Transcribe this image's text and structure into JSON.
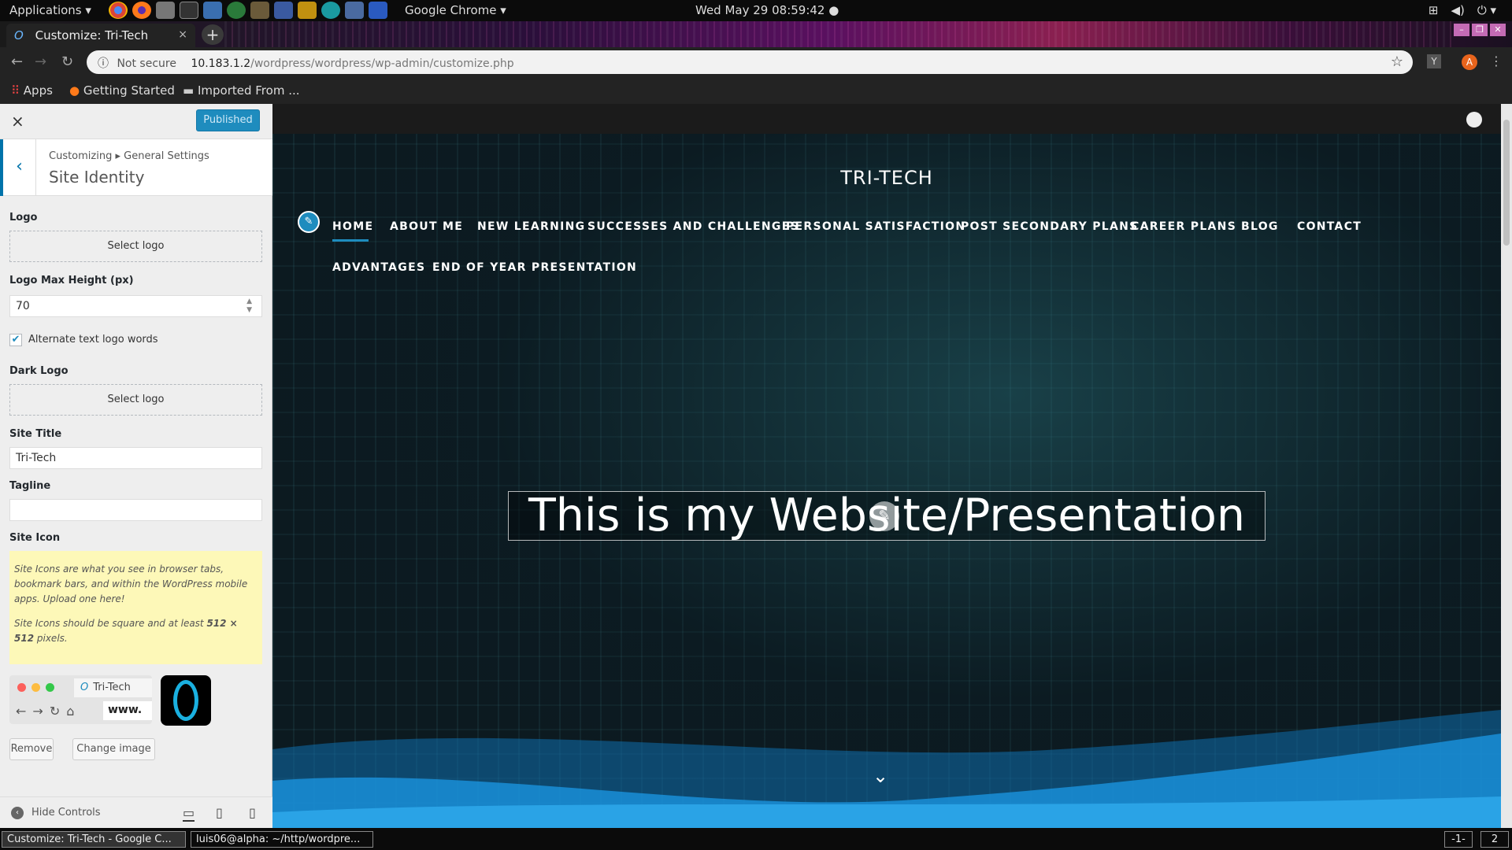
{
  "system": {
    "applications_menu": "Applications ▾",
    "chrome_menu": "Google Chrome ▾",
    "clock": "Wed May 29  08:59:42 ●"
  },
  "browser": {
    "tab_title": "Customize: Tri-Tech",
    "tab_close": "×",
    "new_tab": "+",
    "security": "Not secure",
    "url_host": "10.183.1.2",
    "url_path": "/wordpress/wordpress/wp-admin/customize.php",
    "ext_y": "Y",
    "ext_a": "A",
    "bookmarks": [
      "Apps",
      "Getting Started",
      "Imported From ..."
    ]
  },
  "customizer": {
    "close": "×",
    "publish_button": "Published",
    "breadcrumb": "Customizing ▸ General Settings",
    "section_title": "Site Identity",
    "logo_label": "Logo",
    "select_logo": "Select logo",
    "logo_max_height_label": "Logo Max Height (px)",
    "logo_max_height_value": "70",
    "alt_text_checkbox_label": "Alternate text logo words",
    "alt_text_checked": true,
    "dark_logo_label": "Dark Logo",
    "dark_select_logo": "Select logo",
    "site_title_label": "Site Title",
    "site_title_value": "Tri-Tech",
    "tagline_label": "Tagline",
    "tagline_value": "",
    "site_icon_label": "Site Icon",
    "notice_p1": "Site Icons are what you see in browser tabs, bookmark bars, and within the WordPress mobile apps. Upload one here!",
    "notice_p2_a": "Site Icons should be square and at least ",
    "notice_p2_b": "512 × 512",
    "notice_p2_c": " pixels.",
    "preview_tab_title": "Tri-Tech",
    "preview_url": "www.",
    "remove_button": "Remove",
    "change_image_button": "Change image",
    "hide_controls": "Hide Controls"
  },
  "site": {
    "title": "TRI-TECH",
    "menu": [
      "HOME",
      "ABOUT ME",
      "NEW LEARNING",
      "SUCCESSES AND CHALLENGES",
      "PERSONAL SATISFACTION",
      "POST SECONDARY PLANS",
      "CAREER PLANS",
      "BLOG",
      "CONTACT",
      "ADVANTAGES",
      "END OF YEAR PRESENTATION"
    ],
    "hero_text": "This is my Website/Presentation"
  },
  "taskbar": {
    "task1": "Customize: Tri-Tech - Google C...",
    "task2": "luis06@alpha: ~/http/wordpre...",
    "ws1": "-1-",
    "ws2": "2"
  },
  "colors": {
    "accent": "#1e8cbe",
    "wave_blue": "#1a8fd8"
  }
}
